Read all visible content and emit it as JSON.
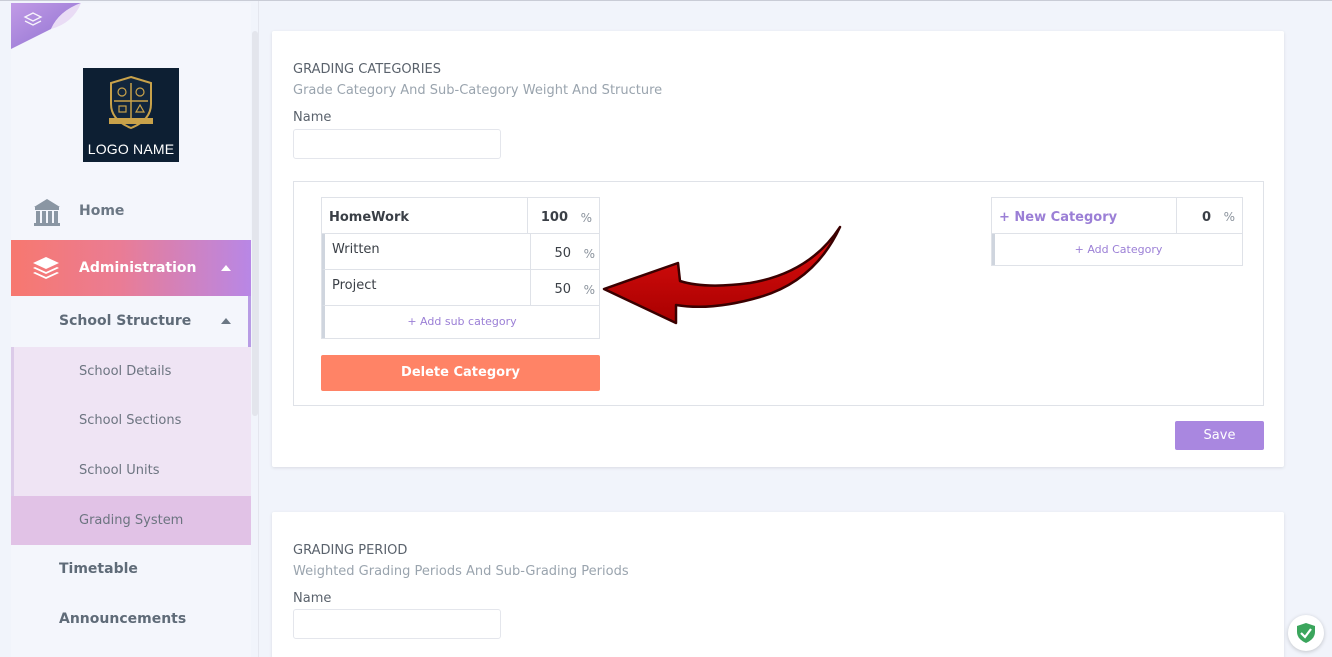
{
  "sidebar": {
    "logo_text": "LOGO NAME",
    "home_label": "Home",
    "admin_label": "Administration",
    "structure_label": "School Structure",
    "sub_items": [
      "School Details",
      "School Sections",
      "School Units",
      "Grading System"
    ],
    "timetable_label": "Timetable",
    "announcements_label": "Announcements"
  },
  "grading_categories": {
    "title": "GRADING CATEGORIES",
    "subtitle": "Grade Category And Sub-Category Weight And Structure",
    "name_label": "Name",
    "name_value": "",
    "category": {
      "name": "HomeWork",
      "weight": "100",
      "subcategories": [
        {
          "name": "Written",
          "weight": "50"
        },
        {
          "name": "Project",
          "weight": "50"
        }
      ],
      "add_sub_label": "+ Add sub category"
    },
    "percent_sign": "%",
    "delete_label": "Delete Category",
    "new_category": {
      "name": "+ New Category",
      "weight": "0",
      "add_label": "+ Add Category"
    },
    "save_label": "Save"
  },
  "grading_period": {
    "title": "GRADING PERIOD",
    "subtitle": "Weighted Grading Periods And Sub-Grading Periods",
    "name_label": "Name",
    "name_value": ""
  },
  "colors": {
    "accent_purple": "#a987e0",
    "delete_orange": "#ff8366",
    "admin_gradient_start": "#f7786f",
    "admin_gradient_end": "#b887e6"
  },
  "icons": [
    "home-icon",
    "layers-icon",
    "shield-check-icon",
    "curved-arrow"
  ]
}
